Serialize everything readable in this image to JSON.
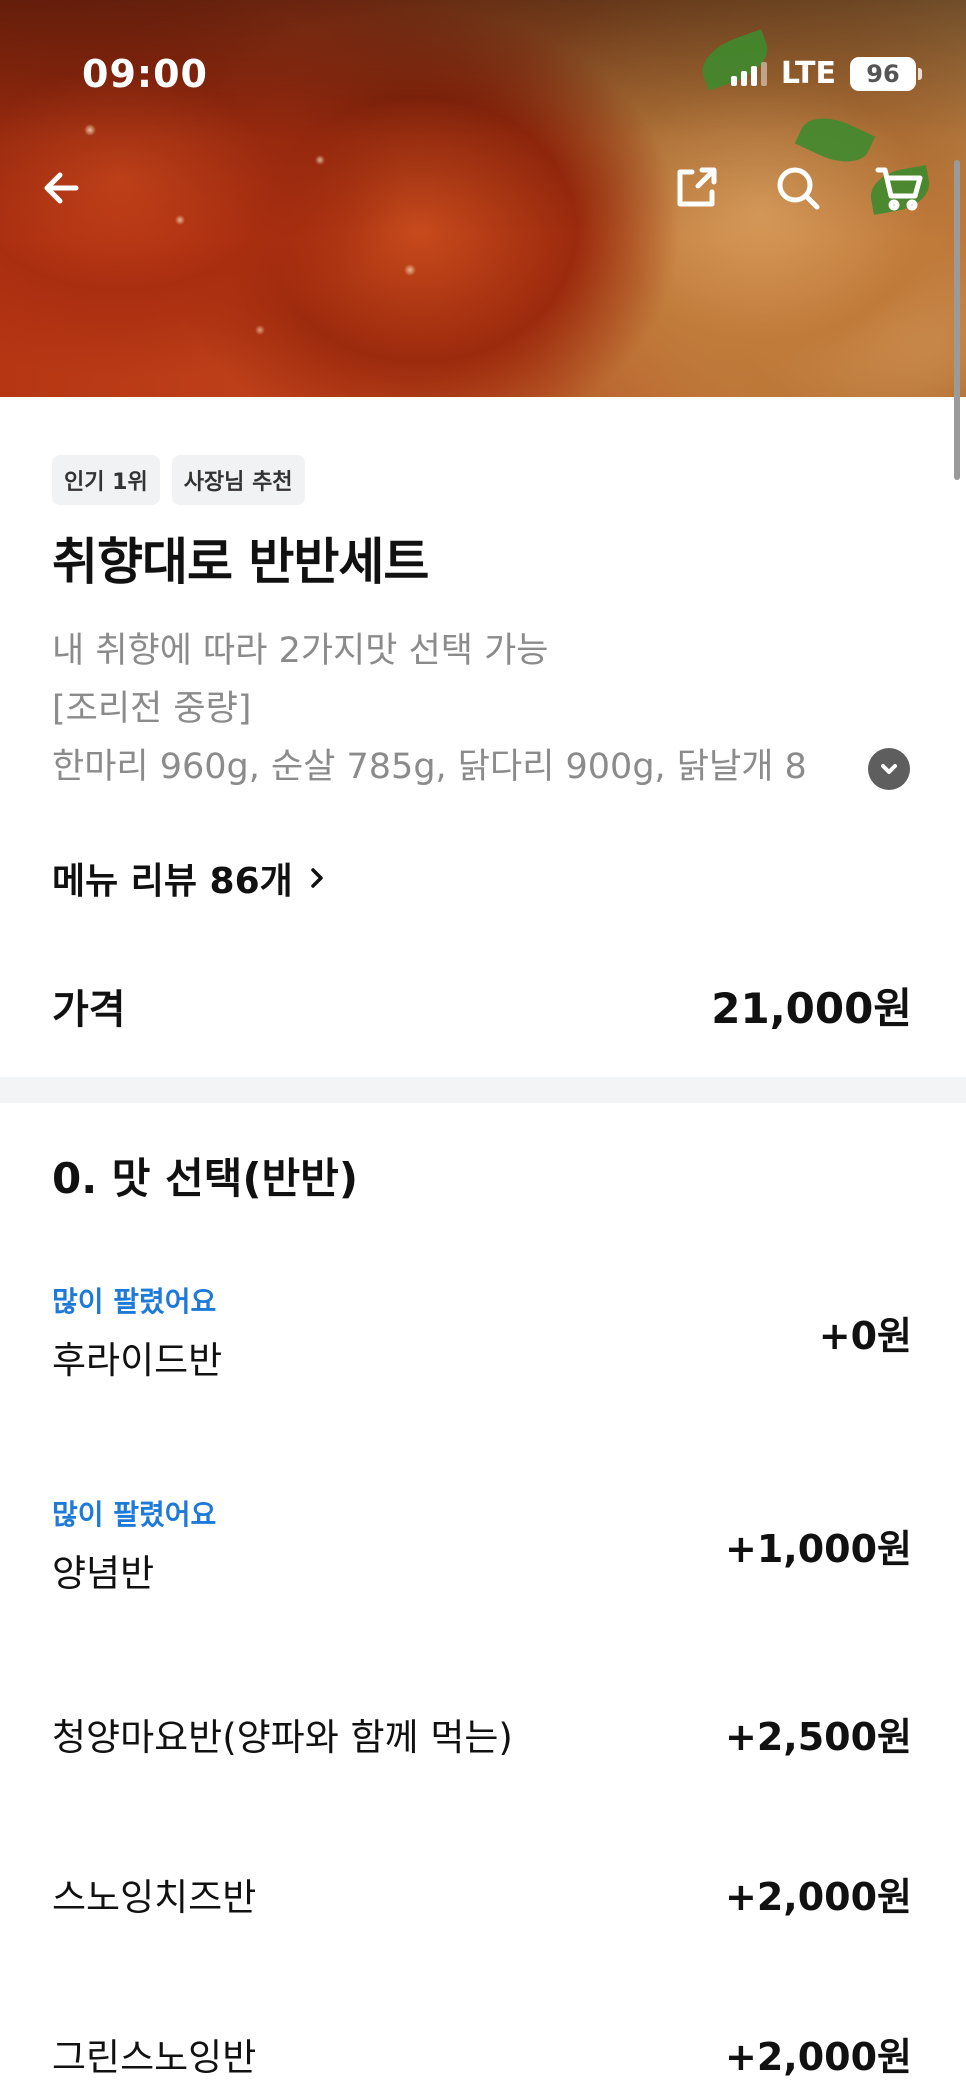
{
  "status": {
    "time": "09:00",
    "network": "LTE",
    "battery": "96"
  },
  "badges": [
    "인기 1위",
    "사장님 추천"
  ],
  "menu": {
    "title": "취향대로 반반세트",
    "description_lines": [
      "내 취향에 따라 2가지맛 선택 가능",
      "[조리전 중량]",
      "한마리 960g, 순살 785g, 닭다리 900g, 닭날개 8"
    ]
  },
  "review_link": "메뉴 리뷰 86개",
  "price": {
    "label": "가격",
    "value": "21,000원"
  },
  "option_group": {
    "title": "0. 맛 선택(반반)",
    "options": [
      {
        "tag": "많이 팔렸어요",
        "name": "후라이드반",
        "price": "+0원"
      },
      {
        "tag": "많이 팔렸어요",
        "name": "양념반",
        "price": "+1,000원"
      },
      {
        "tag": "",
        "name": "청양마요반(양파와 함께 먹는)",
        "price": "+2,500원"
      },
      {
        "tag": "",
        "name": "스노잉치즈반",
        "price": "+2,000원"
      },
      {
        "tag": "",
        "name": "그린스노잉반",
        "price": "+2,000원"
      }
    ]
  },
  "icons": {
    "back": "arrow-left-icon",
    "share": "share-icon",
    "search": "search-icon",
    "cart": "cart-icon",
    "expand": "chevron-down-icon",
    "review_chevron": "chevron-right-icon"
  },
  "colors": {
    "accent_tag": "#1e7ad8",
    "divider": "#f3f4f6"
  }
}
